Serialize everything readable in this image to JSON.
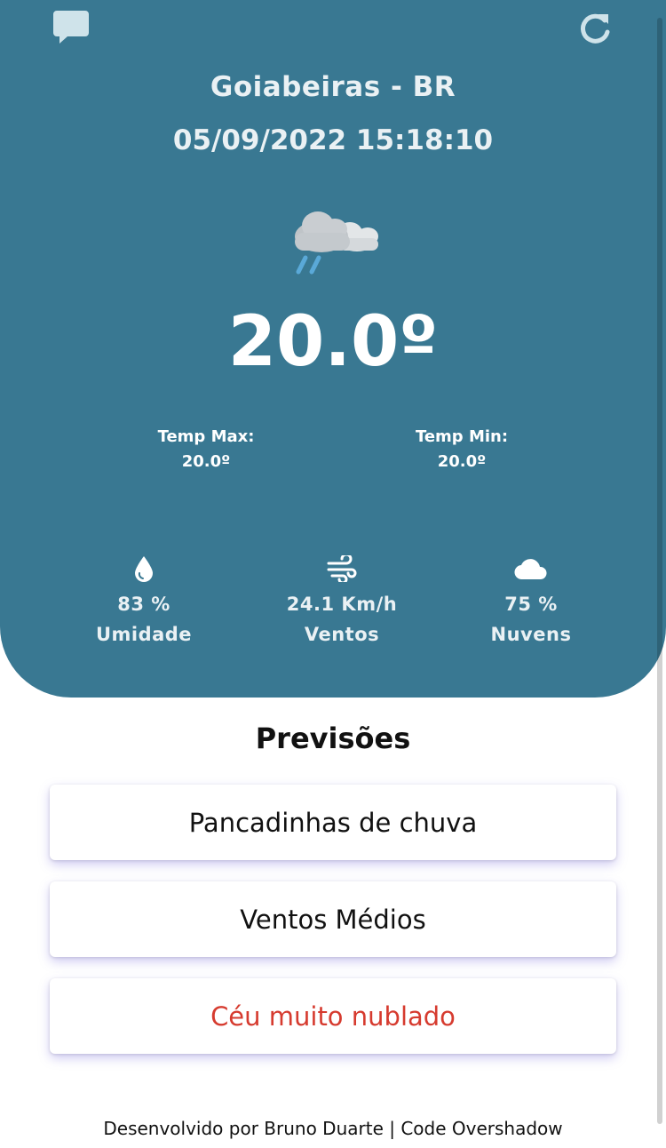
{
  "header": {
    "location": "Goiabeiras - BR",
    "datetime": "05/09/2022 15:18:10"
  },
  "current": {
    "temperature": "20.0º",
    "temp_max_label": "Temp Max:",
    "temp_max_value": "20.0º",
    "temp_min_label": "Temp Min:",
    "temp_min_value": "20.0º"
  },
  "stats": [
    {
      "icon": "water-drop-icon",
      "value": "83 %",
      "label": "Umidade"
    },
    {
      "icon": "wind-icon",
      "value": "24.1 Km/h",
      "label": "Ventos"
    },
    {
      "icon": "cloud-icon",
      "value": "75 %",
      "label": "Nuvens"
    }
  ],
  "forecast": {
    "title": "Previsões",
    "items": [
      {
        "label": "Pancadinhas de chuva"
      },
      {
        "label": "Ventos Médios"
      },
      {
        "label": "Céu muito nublado"
      }
    ]
  },
  "footer": {
    "text": "Desenvolvido por Bruno Duarte | Code Overshadow"
  },
  "colors": {
    "hero_bg": "#397892",
    "alert_text": "#d63b2f"
  }
}
